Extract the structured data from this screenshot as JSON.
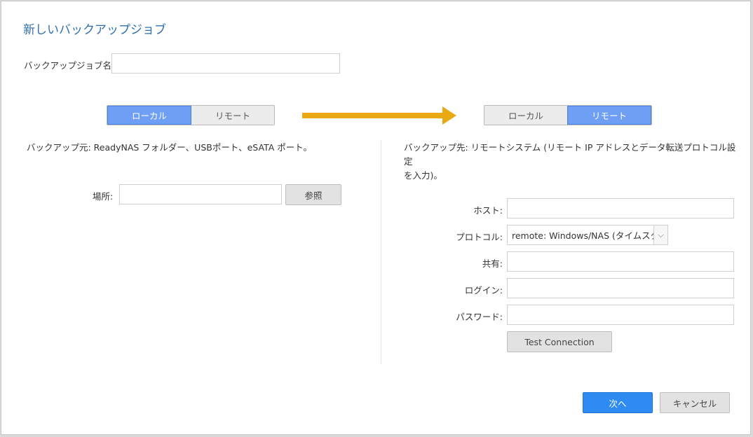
{
  "dialog": {
    "title": "新しいバックアップジョブ",
    "job_name_label": "バックアップジョブ名:",
    "job_name_value": ""
  },
  "source": {
    "toggle": {
      "local": "ローカル",
      "remote": "リモート",
      "selected": "local"
    },
    "description": "バックアップ元: ReadyNAS フォルダー、USBポート、eSATA ポート。",
    "location_label": "場所:",
    "location_value": "",
    "browse_label": "参照"
  },
  "arrow": {
    "color": "#e8a912"
  },
  "destination": {
    "toggle": {
      "local": "ローカル",
      "remote": "リモート",
      "selected": "remote"
    },
    "description_line1": "バックアップ先: リモートシステム (リモート IP アドレスとデータ転送プロトコル設定",
    "description_line2": "を入力)。",
    "host_label": "ホスト:",
    "protocol_label": "プロトコル:",
    "protocol_value": "remote: Windows/NAS (タイムスタンプ)",
    "share_label": "共有:",
    "login_label": "ログイン:",
    "password_label": "パスワード:",
    "test_button": "Test Connection"
  },
  "footer": {
    "next_button": "次へ",
    "cancel_button": "キャンセル"
  },
  "colors": {
    "accent": "#2f8af2",
    "toggle_active": "#6e9ff5",
    "title": "#2f6fae"
  }
}
